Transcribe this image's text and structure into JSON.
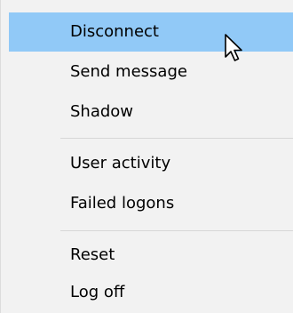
{
  "context_menu": {
    "items": [
      {
        "label": "Disconnect",
        "highlighted": true
      },
      {
        "label": "Send message",
        "highlighted": false
      },
      {
        "label": "Shadow",
        "highlighted": false
      },
      {
        "label": "User activity",
        "highlighted": false
      },
      {
        "label": "Failed logons",
        "highlighted": false
      },
      {
        "label": "Reset",
        "highlighted": false
      },
      {
        "label": "Log off",
        "highlighted": false
      }
    ],
    "highlight_color": "#91c9f7",
    "background_color": "#f2f2f2"
  },
  "cursor": {
    "icon": "mouse-pointer-icon"
  }
}
